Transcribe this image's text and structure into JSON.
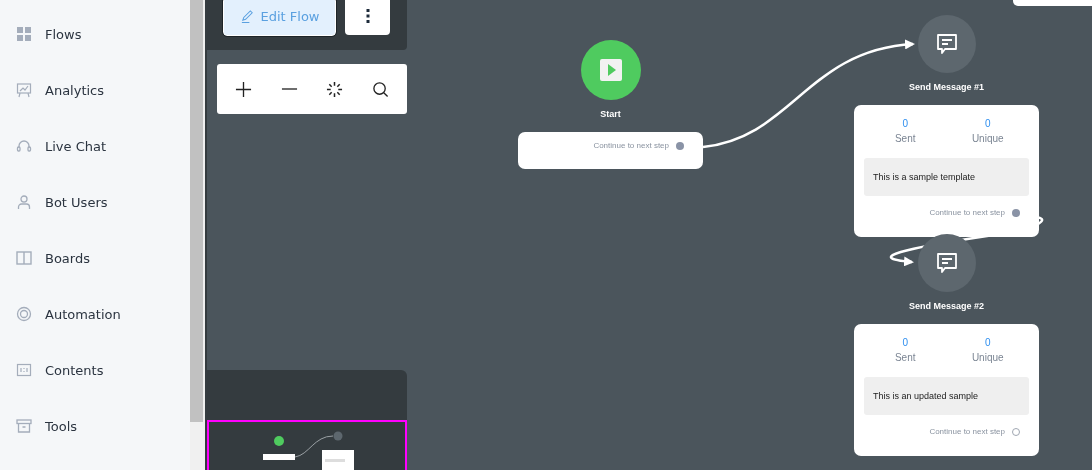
{
  "sidebar": {
    "items": [
      {
        "label": "Flows"
      },
      {
        "label": "Analytics"
      },
      {
        "label": "Live Chat"
      },
      {
        "label": "Bot Users"
      },
      {
        "label": "Boards"
      },
      {
        "label": "Automation"
      },
      {
        "label": "Contents"
      },
      {
        "label": "Tools"
      }
    ]
  },
  "toolbar": {
    "edit_button": "Edit Flow"
  },
  "nodes": [
    {
      "kind": "start",
      "title": "Start",
      "connector": "Continue to next step",
      "connected": true
    },
    {
      "kind": "message",
      "title": "Send Message #1",
      "stats": [
        {
          "value": "0",
          "label": "Sent"
        },
        {
          "value": "0",
          "label": "Unique"
        }
      ],
      "text": "This is a sample template",
      "connector": "Continue to next step",
      "connected": true
    },
    {
      "kind": "message",
      "title": "Send Message #2",
      "stats": [
        {
          "value": "0",
          "label": "Sent"
        },
        {
          "value": "0",
          "label": "Unique"
        }
      ],
      "text": "This is an updated sample",
      "connector": "Continue to next step",
      "connected": false
    }
  ]
}
